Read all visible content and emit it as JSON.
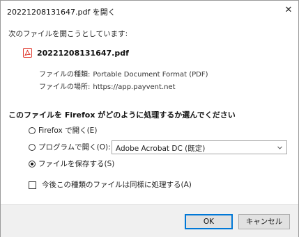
{
  "window": {
    "title": "20221208131647.pdf を開く",
    "close_glyph": "✕"
  },
  "intro": "次のファイルを開こうとしています:",
  "file": {
    "name": "20221208131647.pdf",
    "icon": "pdf-file-icon",
    "type_label": "ファイルの種類:",
    "type_value": "Portable Document Format (PDF)",
    "source_label": "ファイルの場所:",
    "source_value": "https://app.payvent.net"
  },
  "action": {
    "heading": "このファイルを Firefox がどのように処理するか選んでください",
    "options": [
      {
        "label": "Firefox で開く(E)",
        "checked": false
      },
      {
        "label": "プログラムで開く(O):",
        "checked": false
      },
      {
        "label": "ファイルを保存する(S)",
        "checked": true
      }
    ],
    "app_select": {
      "value": "Adobe Acrobat DC (既定)"
    },
    "remember": {
      "label": "今後この種類のファイルは同様に処理する(A)",
      "checked": false
    }
  },
  "buttons": {
    "ok": "OK",
    "cancel": "キャンセル"
  },
  "colors": {
    "pdf_icon_red": "#e03a2f",
    "default_button_border": "#0078d7",
    "footer_bg": "#f0f0f0"
  }
}
